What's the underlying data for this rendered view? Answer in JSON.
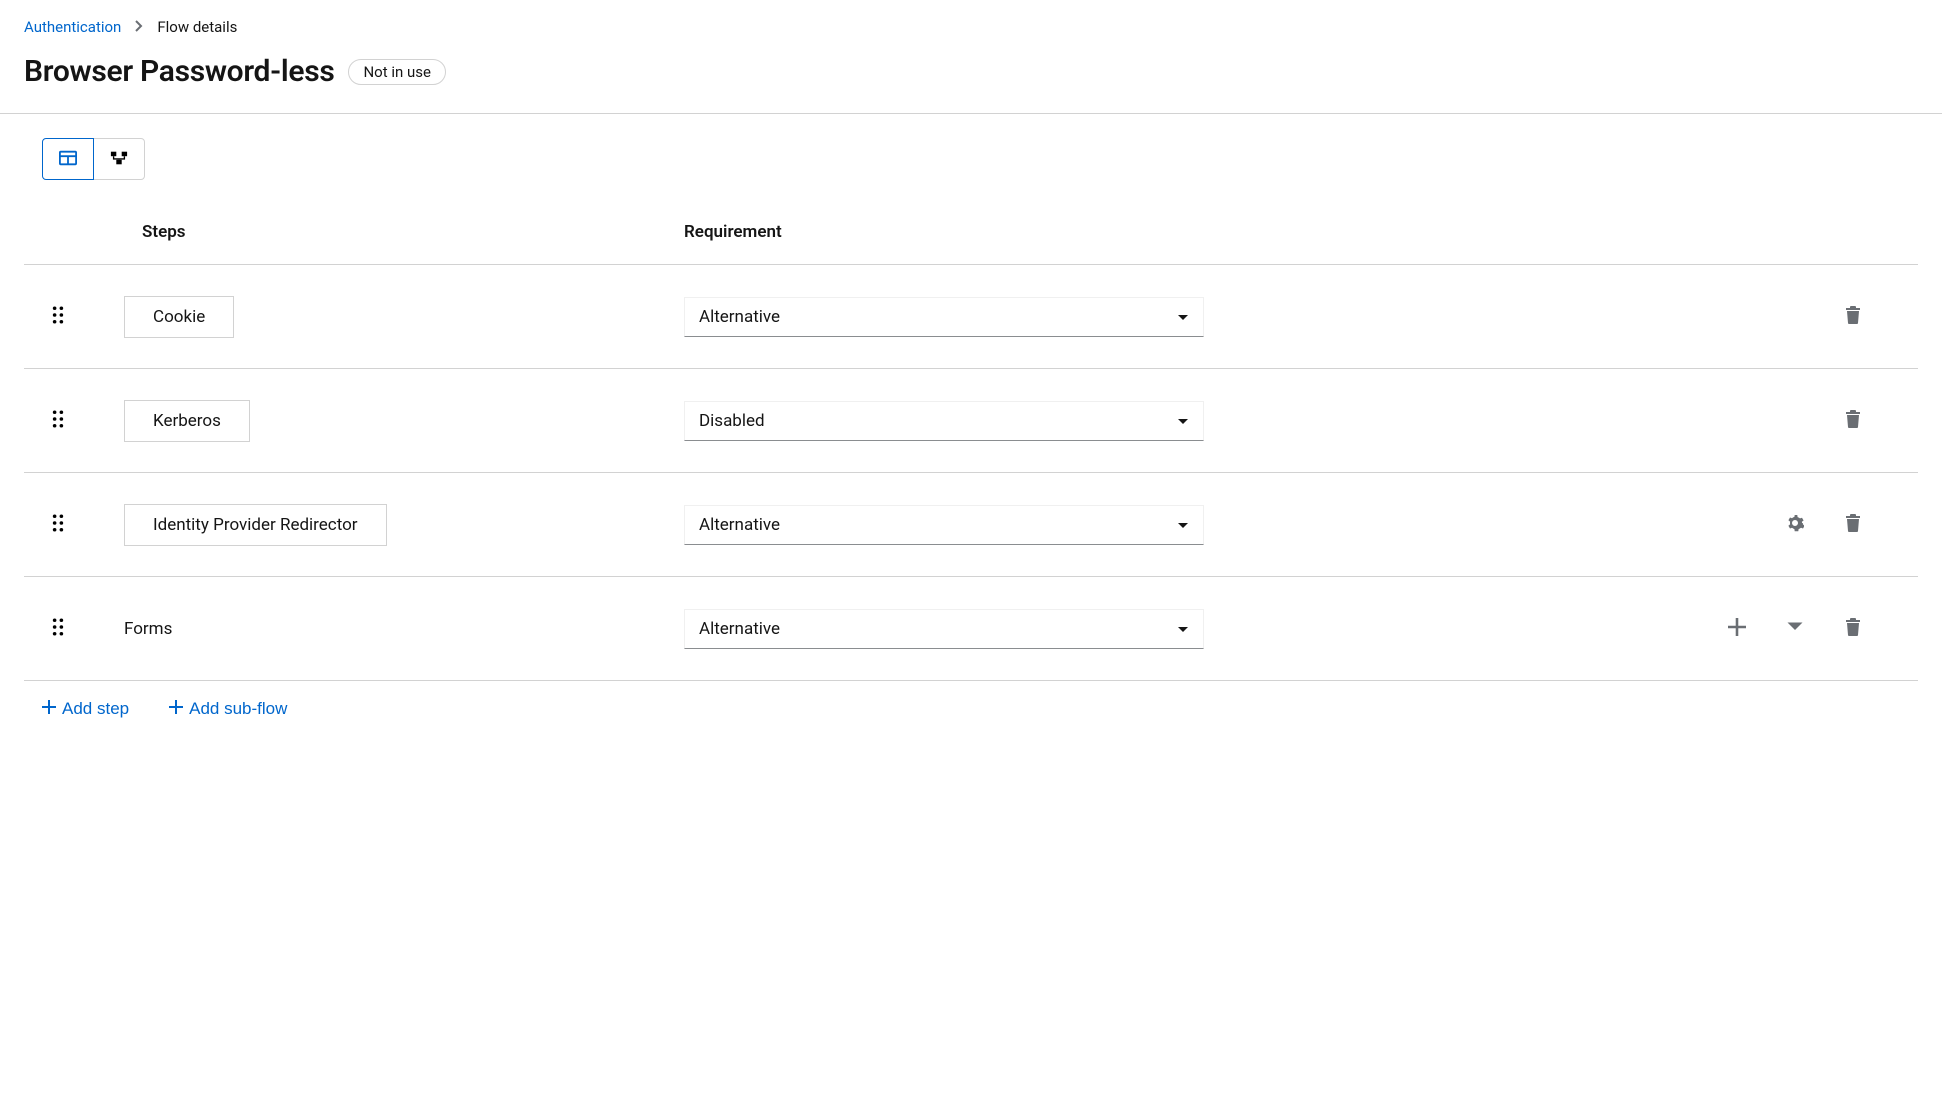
{
  "breadcrumb": {
    "root": "Authentication",
    "current": "Flow details"
  },
  "title": "Browser Password-less",
  "status_badge": "Not in use",
  "columns": {
    "steps": "Steps",
    "requirement": "Requirement"
  },
  "rows": [
    {
      "label": "Cookie",
      "boxed": true,
      "requirement": "Alternative",
      "actions": [
        "delete"
      ]
    },
    {
      "label": "Kerberos",
      "boxed": true,
      "requirement": "Disabled",
      "actions": [
        "delete"
      ]
    },
    {
      "label": "Identity Provider Redirector",
      "boxed": true,
      "requirement": "Alternative",
      "actions": [
        "settings",
        "delete"
      ]
    },
    {
      "label": "Forms",
      "boxed": false,
      "requirement": "Alternative",
      "actions": [
        "add",
        "dropdown",
        "delete"
      ]
    }
  ],
  "footer": {
    "add_step": "Add step",
    "add_subflow": "Add sub-flow"
  }
}
